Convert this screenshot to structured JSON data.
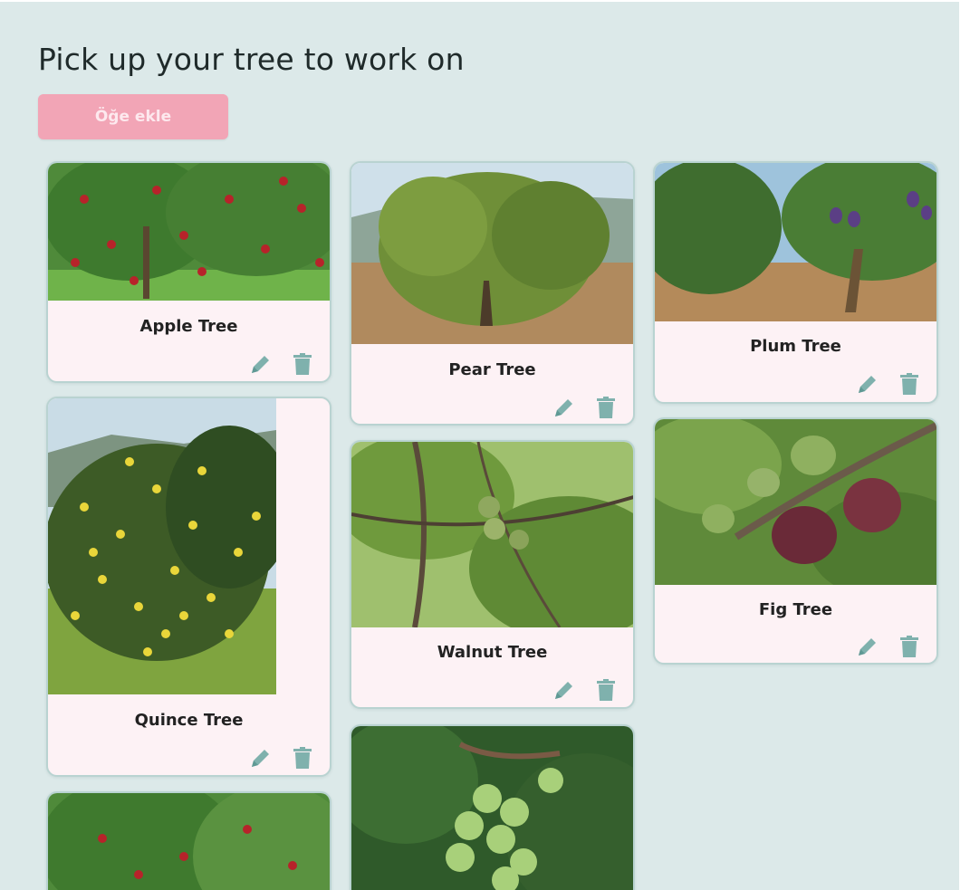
{
  "page": {
    "title": "Pick up your tree to work on"
  },
  "toolbar": {
    "add_label": "Öğe ekle"
  },
  "colors": {
    "accent": "#f2a5b6",
    "icon": "#7fb1ad",
    "background": "#dce9e9",
    "card": "#fdf2f5"
  },
  "icons": {
    "edit": "pencil-icon",
    "delete": "trash-icon"
  },
  "trees": [
    {
      "name": "Apple Tree"
    },
    {
      "name": "Pear Tree"
    },
    {
      "name": "Plum Tree"
    },
    {
      "name": "Quince Tree"
    },
    {
      "name": "Walnut Tree"
    },
    {
      "name": "Fig Tree"
    },
    {
      "name": ""
    },
    {
      "name": ""
    }
  ]
}
